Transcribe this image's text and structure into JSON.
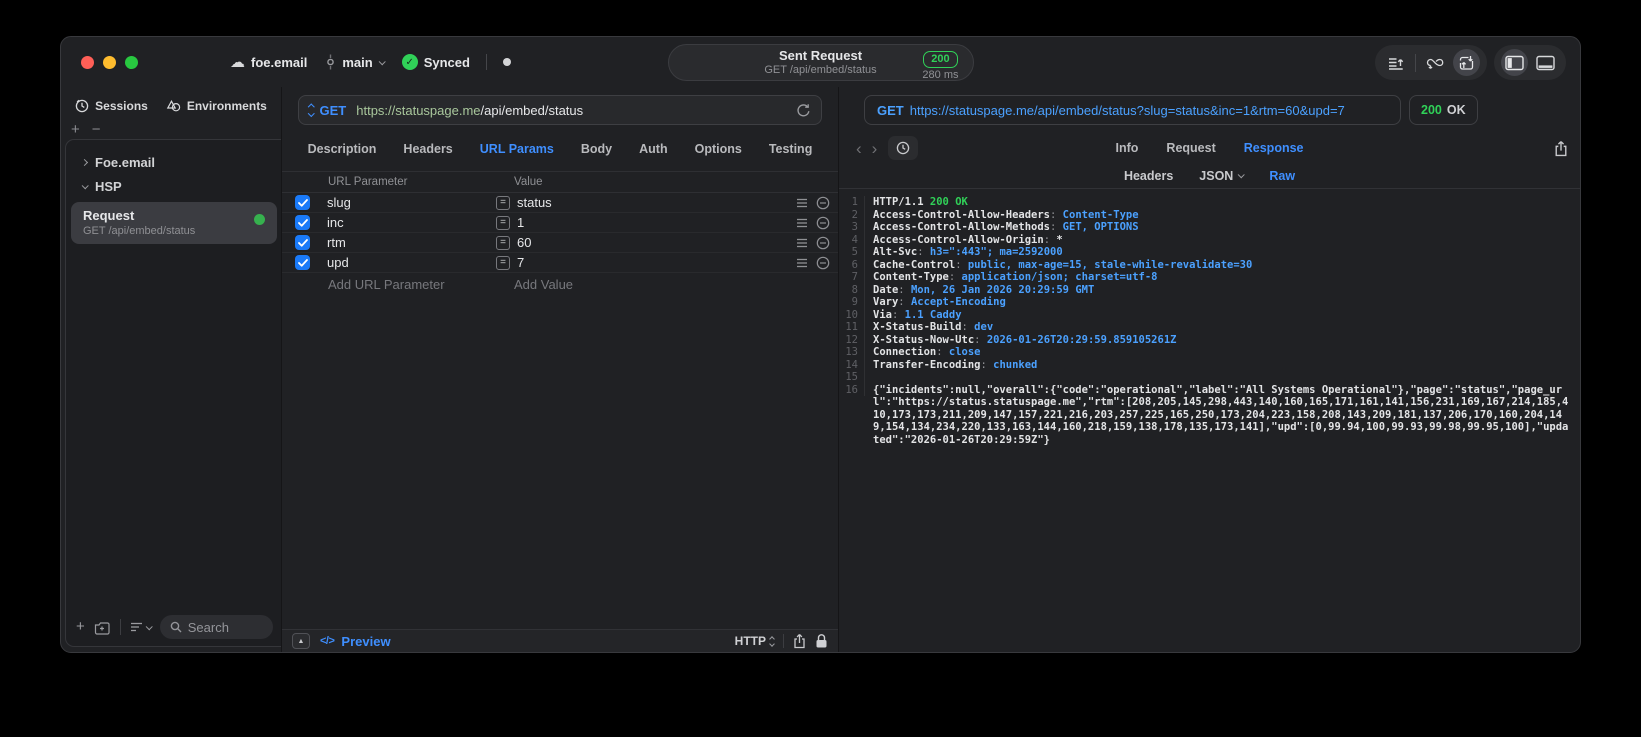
{
  "titlebar": {
    "project": "foe.email",
    "branch": "main",
    "sync_status": "Synced",
    "center": {
      "title": "Sent Request",
      "subtitle": "GET /api/embed/status",
      "status_code": "200",
      "duration": "280 ms"
    }
  },
  "sidebar": {
    "tabs": [
      {
        "label": "Sessions",
        "icon": "clock-icon"
      },
      {
        "label": "Environments",
        "icon": "shapes-icon"
      }
    ],
    "tree": [
      {
        "label": "Foe.email",
        "state": "collapsed"
      },
      {
        "label": "HSP",
        "state": "expanded"
      }
    ],
    "request_item": {
      "title": "Request",
      "subtitle": "GET /api/embed/status",
      "status_color": "#32d74b"
    },
    "search_placeholder": "Search"
  },
  "request_panel": {
    "method": "GET",
    "url_host": "https://statuspage.me",
    "url_path": "/api/embed/status",
    "tabs": [
      "Description",
      "Headers",
      "URL Params",
      "Body",
      "Auth",
      "Options",
      "Testing"
    ],
    "active_tab": "URL Params",
    "table": {
      "columns": [
        "URL Parameter",
        "Value"
      ],
      "rows": [
        {
          "name": "slug",
          "value": "status",
          "enabled": true
        },
        {
          "name": "inc",
          "value": "1",
          "enabled": true
        },
        {
          "name": "rtm",
          "value": "60",
          "enabled": true
        },
        {
          "name": "upd",
          "value": "7",
          "enabled": true
        }
      ],
      "add_name_placeholder": "Add URL Parameter",
      "add_value_placeholder": "Add Value"
    },
    "footer": {
      "code_glyph": "</>",
      "preview_label": "Preview",
      "protocol": "HTTP"
    }
  },
  "response_panel": {
    "method": "GET",
    "request_url": "https://statuspage.me/api/embed/status?slug=status&inc=1&rtm=60&upd=7",
    "status_code": "200",
    "status_text": "OK",
    "tabs": [
      "Info",
      "Request",
      "Response"
    ],
    "active_tab": "Response",
    "subtabs": [
      "Headers",
      "JSON",
      "Raw"
    ],
    "active_subtab": "Raw",
    "code_lines": [
      {
        "n": "1",
        "p": [
          {
            "t": "HTTP/1.1 ",
            "c": "w"
          },
          {
            "t": "200 OK",
            "c": "g"
          }
        ]
      },
      {
        "n": "2",
        "p": [
          {
            "t": "Access-Control-Allow-Headers",
            "c": "w"
          },
          {
            "t": ": ",
            "c": "d"
          },
          {
            "t": "Content-Type",
            "c": "b"
          }
        ]
      },
      {
        "n": "3",
        "p": [
          {
            "t": "Access-Control-Allow-Methods",
            "c": "w"
          },
          {
            "t": ": ",
            "c": "d"
          },
          {
            "t": "GET, OPTIONS",
            "c": "b"
          }
        ]
      },
      {
        "n": "4",
        "p": [
          {
            "t": "Access-Control-Allow-Origin",
            "c": "w"
          },
          {
            "t": ": ",
            "c": "d"
          },
          {
            "t": "*",
            "c": "w"
          }
        ]
      },
      {
        "n": "5",
        "p": [
          {
            "t": "Alt-Svc",
            "c": "w"
          },
          {
            "t": ": ",
            "c": "d"
          },
          {
            "t": "h3=\":443\"; ma=2592000",
            "c": "b"
          }
        ]
      },
      {
        "n": "6",
        "p": [
          {
            "t": "Cache-Control",
            "c": "w"
          },
          {
            "t": ": ",
            "c": "d"
          },
          {
            "t": "public, max-age=15, stale-while-revalidate=30",
            "c": "b"
          }
        ]
      },
      {
        "n": "7",
        "p": [
          {
            "t": "Content-Type",
            "c": "w"
          },
          {
            "t": ": ",
            "c": "d"
          },
          {
            "t": "application/json; charset=utf-8",
            "c": "b"
          }
        ]
      },
      {
        "n": "8",
        "p": [
          {
            "t": "Date",
            "c": "w"
          },
          {
            "t": ": ",
            "c": "d"
          },
          {
            "t": "Mon, 26 Jan 2026 20:29:59 GMT",
            "c": "b"
          }
        ]
      },
      {
        "n": "9",
        "p": [
          {
            "t": "Vary",
            "c": "w"
          },
          {
            "t": ": ",
            "c": "d"
          },
          {
            "t": "Accept-Encoding",
            "c": "b"
          }
        ]
      },
      {
        "n": "10",
        "p": [
          {
            "t": "Via",
            "c": "w"
          },
          {
            "t": ": ",
            "c": "d"
          },
          {
            "t": "1.1 Caddy",
            "c": "b"
          }
        ]
      },
      {
        "n": "11",
        "p": [
          {
            "t": "X-Status-Build",
            "c": "w"
          },
          {
            "t": ": ",
            "c": "d"
          },
          {
            "t": "dev",
            "c": "b"
          }
        ]
      },
      {
        "n": "12",
        "p": [
          {
            "t": "X-Status-Now-Utc",
            "c": "w"
          },
          {
            "t": ": ",
            "c": "d"
          },
          {
            "t": "2026-01-26T20:29:59.859105261Z",
            "c": "b"
          }
        ]
      },
      {
        "n": "13",
        "p": [
          {
            "t": "Connection",
            "c": "w"
          },
          {
            "t": ": ",
            "c": "d"
          },
          {
            "t": "close",
            "c": "b"
          }
        ]
      },
      {
        "n": "14",
        "p": [
          {
            "t": "Transfer-Encoding",
            "c": "w"
          },
          {
            "t": ": ",
            "c": "d"
          },
          {
            "t": "chunked",
            "c": "b"
          }
        ]
      },
      {
        "n": "15",
        "p": []
      },
      {
        "n": "16",
        "p": [
          {
            "t": "{\"incidents\":null,\"overall\":{\"code\":\"operational\",\"label\":\"All Systems Operational\"},\"page\":\"status\",\"page_url\":\"https://status.statuspage.me\",\"rtm\":[208,205,145,298,443,140,160,165,171,161,141,156,231,169,167,214,185,410,173,173,211,209,147,157,221,216,203,257,225,165,250,173,204,223,158,208,143,209,181,137,206,170,160,204,149,154,134,234,220,133,163,144,160,218,159,138,178,135,173,141],\"upd\":[0,99.94,100,99.93,99.98,99.95,100],\"updated\":\"2026-01-26T20:29:59Z\"}",
            "c": "body"
          }
        ]
      }
    ]
  }
}
